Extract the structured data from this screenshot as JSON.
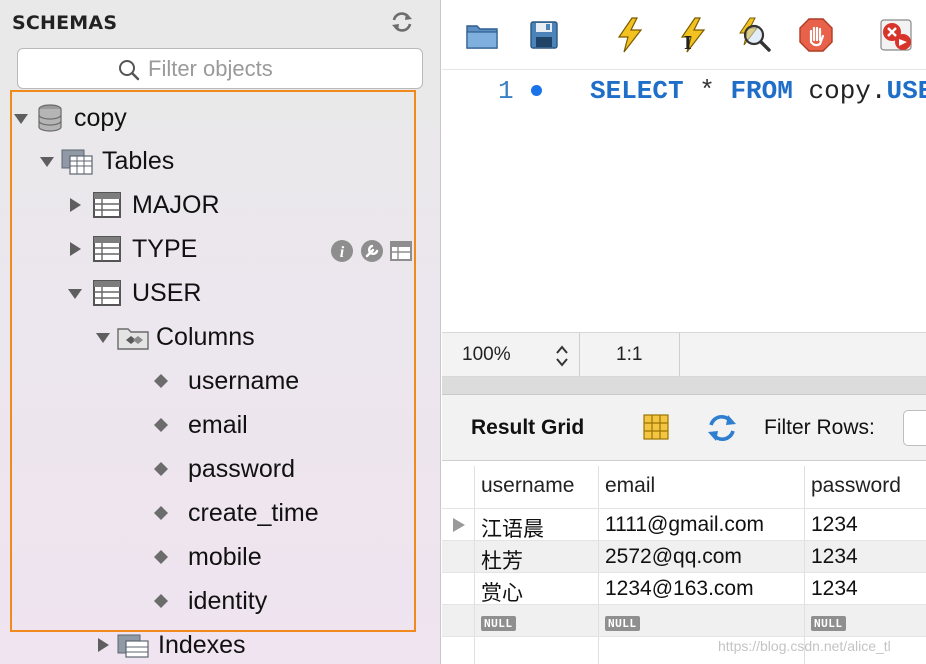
{
  "schemas": {
    "title": "SCHEMAS",
    "filter_placeholder": "Filter objects",
    "tree": {
      "schema": "copy",
      "tables_label": "Tables",
      "tables": [
        "MAJOR",
        "TYPE",
        "USER"
      ],
      "columns_label": "Columns",
      "columns": [
        "username",
        "email",
        "password",
        "create_time",
        "mobile",
        "identity"
      ],
      "indexes_label": "Indexes"
    }
  },
  "editor": {
    "line_number": "1",
    "sql": {
      "kw1": "SELECT",
      "star": "*",
      "kw2": "FROM",
      "target_prefix": "copy.",
      "target_kw": "USE"
    }
  },
  "status_bar": {
    "zoom": "100%",
    "cursor": "1:1"
  },
  "result": {
    "title": "Result Grid",
    "filter_label": "Filter Rows:",
    "columns": [
      "username",
      "email",
      "password"
    ],
    "rows": [
      [
        "江语晨",
        "1111@gmail.com",
        "1234"
      ],
      [
        "杜芳",
        "2572@qq.com",
        "1234"
      ],
      [
        "赏心",
        "1234@163.com",
        "1234"
      ]
    ],
    "null_label": "NULL"
  },
  "watermark": "https://blog.csdn.net/alice_tl",
  "colors": {
    "accent_frame": "#f08a1c",
    "sql_keyword": "#1f6ec7",
    "line_marker": "#1a73e8"
  },
  "icons": [
    "refresh-icon",
    "search-icon",
    "database-icon",
    "tables-folder-icon",
    "table-icon",
    "columns-folder-icon",
    "column-diamond-icon",
    "info-icon",
    "wrench-icon",
    "table-grid-icon",
    "open-folder-icon",
    "save-icon",
    "execute-lightning-icon",
    "execute-current-icon",
    "explain-icon",
    "stop-icon",
    "toggle-error-icon",
    "grid-view-icon",
    "reload-icon"
  ]
}
